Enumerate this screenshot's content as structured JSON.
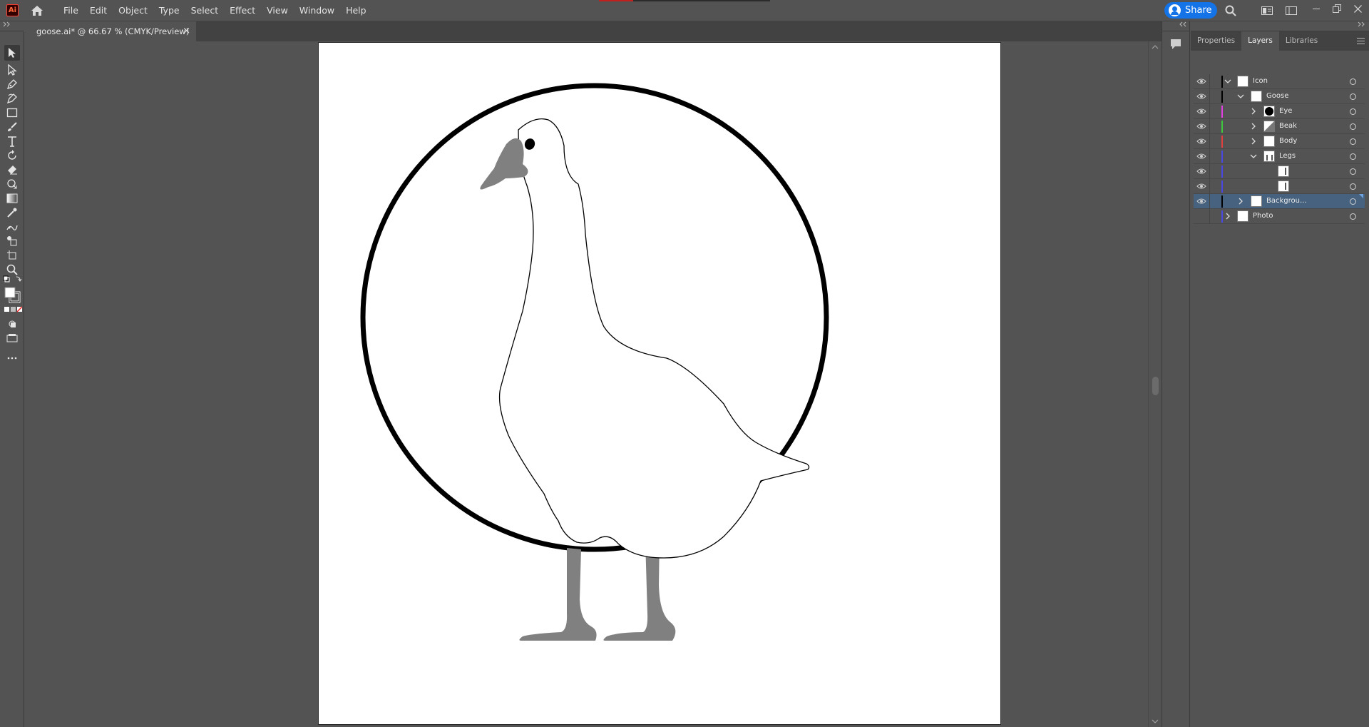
{
  "app": {
    "logo_text": "Ai",
    "brand_color": "#ff3b2f"
  },
  "menu": [
    "File",
    "Edit",
    "Object",
    "Type",
    "Select",
    "Effect",
    "View",
    "Window",
    "Help"
  ],
  "share": {
    "label": "Share",
    "color": "#1473e6"
  },
  "document": {
    "tab_title": "goose.ai* @ 66.67 % (CMYK/Preview)",
    "close_glyph": "×"
  },
  "panel": {
    "tabs": [
      "Properties",
      "Layers",
      "Libraries"
    ],
    "active_tab": "Layers"
  },
  "layers": [
    {
      "name": "Icon",
      "color": "#000000",
      "chevron": "down",
      "depth": 0,
      "thumb": "goose-thumb"
    },
    {
      "name": "Goose",
      "color": "#000000",
      "chevron": "down",
      "depth": 1,
      "thumb": "goose-thumb"
    },
    {
      "name": "Eye",
      "color": "#e040e0",
      "chevron": "right",
      "depth": 2,
      "thumb": "eye-thumb"
    },
    {
      "name": "Beak",
      "color": "#3ec83e",
      "chevron": "right",
      "depth": 2,
      "thumb": "beak-thumb"
    },
    {
      "name": "Body",
      "color": "#e04040",
      "chevron": "right",
      "depth": 2,
      "thumb": "body-thumb"
    },
    {
      "name": "Legs",
      "color": "#4a4ae0",
      "chevron": "down",
      "depth": 2,
      "thumb": "legs-thumb"
    },
    {
      "name": "",
      "color": "#4a4ae0",
      "chevron": "none",
      "depth": 3,
      "thumb": "leg-thumb"
    },
    {
      "name": "",
      "color": "#4a4ae0",
      "chevron": "none",
      "depth": 3,
      "thumb": "leg-thumb"
    },
    {
      "name": "Backgrou...",
      "color": "#000000",
      "chevron": "right",
      "depth": 1,
      "thumb": "blank-thumb",
      "selected": true
    },
    {
      "name": "Photo",
      "color": "#4a4ae0",
      "chevron": "right",
      "depth": 0,
      "thumb": "photo-thumb",
      "no_eye": true
    }
  ],
  "colors": {
    "ui_bg": "#535353",
    "selection": "#46627f",
    "goose_gray": "#808080"
  }
}
